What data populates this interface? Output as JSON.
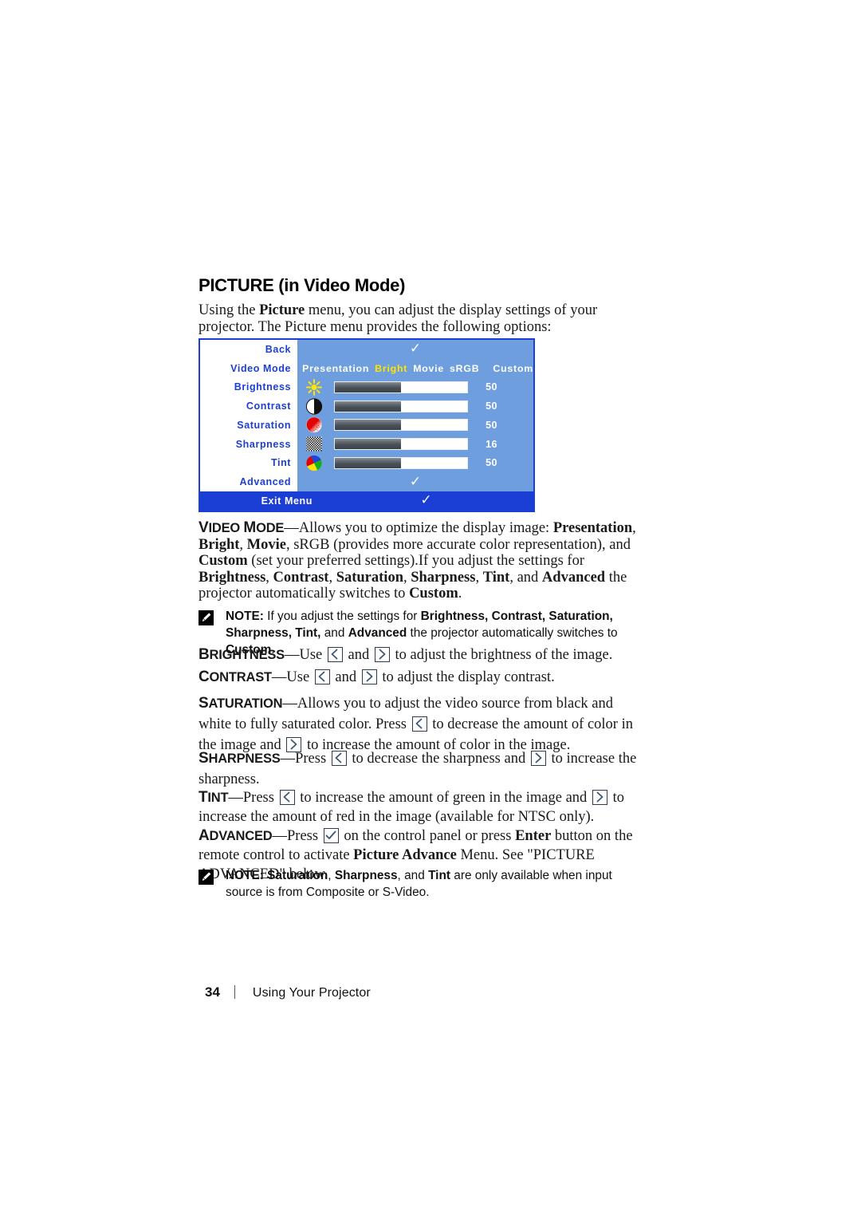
{
  "page": {
    "heading": "PICTURE (in Video Mode)",
    "intro": "Using the Picture menu, you can adjust the display settings of your projector. The Picture menu provides the following options:",
    "footer": {
      "page_number": "34",
      "section": "Using Your Projector"
    }
  },
  "osd": {
    "colors": {
      "border": "#1b3fd4",
      "panel": "#6e9ede",
      "left_panel": "#ffffff",
      "label": "#1b3fd4",
      "highlight": "#ffe500",
      "exit_bar": "#1b3fd4"
    },
    "rows": [
      {
        "label": "Back",
        "type": "check",
        "check": "✓"
      },
      {
        "label": "Video Mode",
        "type": "options"
      },
      {
        "label": "Brightness",
        "type": "slider",
        "icon": "brightness-sun-icon",
        "value": "50",
        "fill_percent": 50
      },
      {
        "label": "Contrast",
        "type": "slider",
        "icon": "contrast-halfcircle-icon",
        "value": "50",
        "fill_percent": 50
      },
      {
        "label": "Saturation",
        "type": "slider",
        "icon": "saturation-red-circle-icon",
        "value": "50",
        "fill_percent": 50
      },
      {
        "label": "Sharpness",
        "type": "slider",
        "icon": "sharpness-checkerboard-icon",
        "value": "16",
        "fill_percent": 50
      },
      {
        "label": "Tint",
        "type": "slider",
        "icon": "tint-colorwheel-icon",
        "value": "50",
        "fill_percent": 50
      },
      {
        "label": "Advanced",
        "type": "check",
        "check": "✓"
      }
    ],
    "video_mode_options": [
      {
        "label": "Presentation",
        "selected": false
      },
      {
        "label": "Bright",
        "selected": true
      },
      {
        "label": "Movie",
        "selected": false
      },
      {
        "label": "sRGB",
        "selected": false
      },
      {
        "label": "Custom",
        "selected": false
      }
    ],
    "exit": {
      "label": "Exit Menu",
      "check": "✓"
    }
  },
  "sections": {
    "video_mode": {
      "term": "Video Mode",
      "body_html": "—Allows you to optimize the display image: <b>Presentation</b>, <b>Bright</b>, <b>Movie</b>, sRGB (provides more accurate color representation), and <b>Custom</b> (set your preferred settings).If you adjust the settings for <b>Brightness</b>, <b>Contrast</b>, <b>Saturation</b>, <b>Sharpness</b>, <b>Tint</b>, and <b>Advanced</b> the projector automatically switches to <b>Custom</b>."
    },
    "note1": {
      "label": "NOTE:",
      "body_html": " If you adjust the settings for <b>Brightness, Contrast, Saturation, Sharpness, Tint,</b> and <b>Advanced</b> the projector automatically switches to <b>Custom</b>."
    },
    "brightness": {
      "term": "Brightness",
      "parts": [
        "—Use ",
        " and ",
        " to adjust the brightness of the image."
      ]
    },
    "contrast": {
      "term": "Contrast",
      "parts": [
        "—Use ",
        " and ",
        " to adjust the display contrast."
      ]
    },
    "saturation": {
      "term": "Saturation",
      "parts": [
        "—Allows you to adjust the video source from black and white to fully saturated color. Press ",
        " to decrease the amount of color in the image and ",
        " to increase the amount of color in the image."
      ]
    },
    "sharpness": {
      "term": "Sharpness",
      "parts": [
        "—Press ",
        " to decrease the sharpness and ",
        " to increase the sharpness."
      ]
    },
    "tint": {
      "term": "Tint",
      "parts": [
        "—Press ",
        " to increase the amount of green in the image and ",
        " to increase the amount of red in the image (available for NTSC only)."
      ]
    },
    "advanced": {
      "term": "Advanced",
      "part1": "—Press ",
      "part2_html": " on the control panel or press <b>Enter</b> button on the remote control to activate <b>Picture Advance</b> Menu. See \"PICTURE ADVANCED\" below."
    },
    "note2": {
      "label": "NOTE:",
      "body_html": " <b>Saturation</b>, <b>Sharpness</b>, and <b>Tint</b> are only available when input source is from Composite or S-Video."
    }
  }
}
